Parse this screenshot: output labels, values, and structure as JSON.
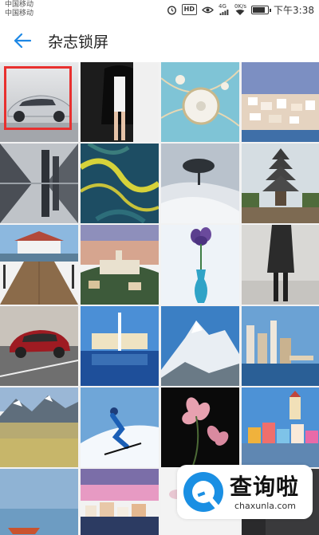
{
  "status_bar": {
    "carrier_1": "中国移动",
    "carrier_2": "中国移动",
    "hd_badge": "HD",
    "network_4g": "4G",
    "network_speed": "0K/s",
    "time": "下午3:38",
    "battery_level": 0.85,
    "icons": [
      "alarm-icon",
      "hd-icon",
      "eye-icon",
      "signal-icon",
      "wifi-icon",
      "battery-icon"
    ]
  },
  "header": {
    "back_icon": "arrow-left-icon",
    "title": "杂志锁屏",
    "accent_color": "#1e88e5"
  },
  "gallery": {
    "selected_index": 0,
    "selected_color": "#e8302f",
    "tiles": [
      {
        "name": "concept-car"
      },
      {
        "name": "fashion-model-black-coat"
      },
      {
        "name": "jewelry-necklace"
      },
      {
        "name": "seaside-white-town"
      },
      {
        "name": "mirrored-city-towers"
      },
      {
        "name": "aerial-river-delta"
      },
      {
        "name": "desert-tree-dunes"
      },
      {
        "name": "wooden-pagoda"
      },
      {
        "name": "pier-lighthouse"
      },
      {
        "name": "hilltop-village-sunset"
      },
      {
        "name": "iris-blue-vase"
      },
      {
        "name": "runway-model-gray"
      },
      {
        "name": "red-bentley-car"
      },
      {
        "name": "palace-fountain-night"
      },
      {
        "name": "snow-mountain-peak"
      },
      {
        "name": "harbor-skyline"
      },
      {
        "name": "volcano-lake-landscape"
      },
      {
        "name": "skier-powder"
      },
      {
        "name": "pink-lily-flowers"
      },
      {
        "name": "colorful-hillside-castle"
      },
      {
        "name": "boats-on-lake"
      },
      {
        "name": "coastal-town-dusk"
      },
      {
        "name": "white-orchid"
      },
      {
        "name": "dark-interior"
      }
    ]
  },
  "watermark": {
    "brand_cn": "查询啦",
    "brand_en": "chaxunla.com",
    "logo_color": "#1a8fe3"
  }
}
